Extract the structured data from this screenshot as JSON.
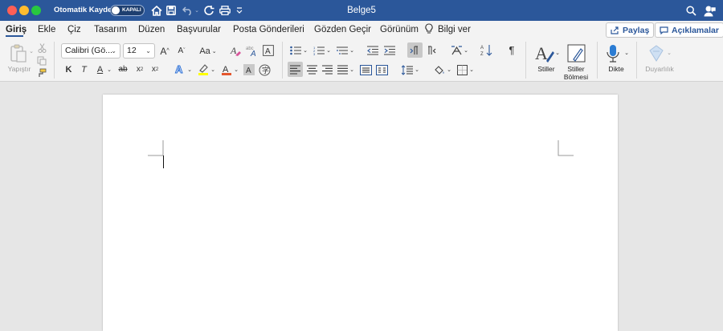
{
  "window": {
    "title": "Belge5",
    "autosave_label": "Otomatik Kaydet",
    "autosave_state": "KAPALI"
  },
  "menu": {
    "tabs": [
      "Giriş",
      "Ekle",
      "Çiz",
      "Tasarım",
      "Düzen",
      "Başvurular",
      "Posta Gönderileri",
      "Gözden Geçir",
      "Görünüm"
    ],
    "tell_me": "Bilgi ver",
    "share": "Paylaş",
    "comments": "Açıklamalar"
  },
  "ribbon": {
    "paste_label": "Yapıştır",
    "font_name": "Calibri (Gö...",
    "font_size": "12",
    "bold": "K",
    "italic": "T",
    "underline": "A",
    "strike": "ab",
    "subscript": "x",
    "superscript": "x",
    "change_case": "Aa",
    "grow_font": "A",
    "shrink_font": "A",
    "styles_label": "Stiller",
    "styles_pane_label_1": "Stiller",
    "styles_pane_label_2": "Bölmesi",
    "dictate_label": "Dikte",
    "sensitivity_label": "Duyarlılık"
  },
  "colors": {
    "brand": "#2b579a",
    "highlight": "#ffff00",
    "font_color": "#e4572e"
  }
}
